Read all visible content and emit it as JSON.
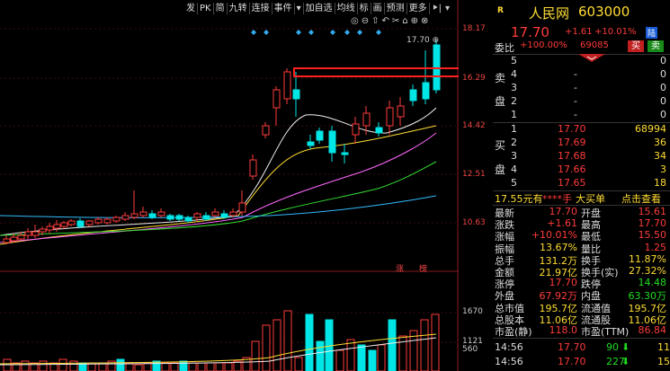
{
  "toolbar": {
    "items": [
      "发",
      "PK",
      "简",
      "九转",
      "连接",
      "事件"
    ],
    "arrow": "▾",
    "items2": [
      "加自选",
      "均线",
      "标",
      "画",
      "预测",
      "更多"
    ],
    "end1": "⯈|",
    "end2": "▾"
  },
  "chart": {
    "price_ticks": [
      "18.17",
      "16.29",
      "14.42",
      "12.51",
      "10.63"
    ],
    "vol_ticks": [
      "1670",
      "1121",
      "560"
    ],
    "high_label": "17.70",
    "zhang_labels": [
      "涨",
      "榜"
    ],
    "icons": [
      "zoom-in-icon",
      "zoom-out-icon",
      "up-icon",
      "back-icon",
      "scissors-icon",
      "lock-icon",
      "plus-icon",
      "close-icon"
    ]
  },
  "quote": {
    "logo": "R",
    "name": "人民网",
    "code": "603000",
    "price": "17.70",
    "change": "+1.61",
    "change_pct": "+10.01%",
    "tag": "陆",
    "weibi_label": "委比",
    "weibi_value": "+100.00%",
    "weicha_value": "69085",
    "buy_btn": "买",
    "sell_btn": "卖",
    "sell_label_chars": [
      "卖",
      "盘"
    ],
    "buy_label_chars": [
      "买",
      "盘"
    ],
    "sells": [
      {
        "lvl": "5",
        "price": "",
        "vol": "0"
      },
      {
        "lvl": "4",
        "price": "-",
        "vol": "0"
      },
      {
        "lvl": "3",
        "price": "-",
        "vol": "0"
      },
      {
        "lvl": "2",
        "price": "-",
        "vol": "0"
      },
      {
        "lvl": "1",
        "price": "-",
        "vol": "0"
      }
    ],
    "buys": [
      {
        "lvl": "1",
        "price": "17.70",
        "vol": "68994"
      },
      {
        "lvl": "2",
        "price": "17.69",
        "vol": "36"
      },
      {
        "lvl": "3",
        "price": "17.68",
        "vol": "34"
      },
      {
        "lvl": "4",
        "price": "17.66",
        "vol": "3"
      },
      {
        "lvl": "5",
        "price": "17.65",
        "vol": "18"
      }
    ],
    "bigbuy": {
      "price": "17.55元有",
      "mask": "****手",
      "label": "大买单",
      "link": "点击查看"
    },
    "stats": [
      [
        "最新",
        "17.70",
        "开盘",
        "15.61"
      ],
      [
        "涨跌",
        "+1.61",
        "最高",
        "17.70"
      ],
      [
        "涨幅",
        "+10.01%",
        "最低",
        "15.50"
      ],
      [
        "振幅",
        "13.67%",
        "量比",
        "1.25"
      ],
      [
        "总手",
        "131.2万",
        "换手",
        "11.87%"
      ],
      [
        "金额",
        "21.97亿",
        "换手(实)",
        "27.32%"
      ],
      [
        "涨停",
        "17.70",
        "跌停",
        "14.48"
      ],
      [
        "外盘",
        "67.92万",
        "内盘",
        "63.30万"
      ],
      [
        "总市值",
        "195.7亿",
        "流通值",
        "195.7亿"
      ],
      [
        "总股本",
        "11.06亿",
        "流通股",
        "11.06亿"
      ],
      [
        "市盈(静)",
        "118.0",
        "市盈(TTM)",
        "86.84"
      ]
    ],
    "ticks": [
      {
        "time": "14:56",
        "price": "17.70",
        "vol": "90",
        "arrow": "⬇",
        "extra": "11"
      },
      {
        "time": "14:56",
        "price": "17.70",
        "vol": "227",
        "arrow": "⬇",
        "extra": "15"
      }
    ]
  }
}
